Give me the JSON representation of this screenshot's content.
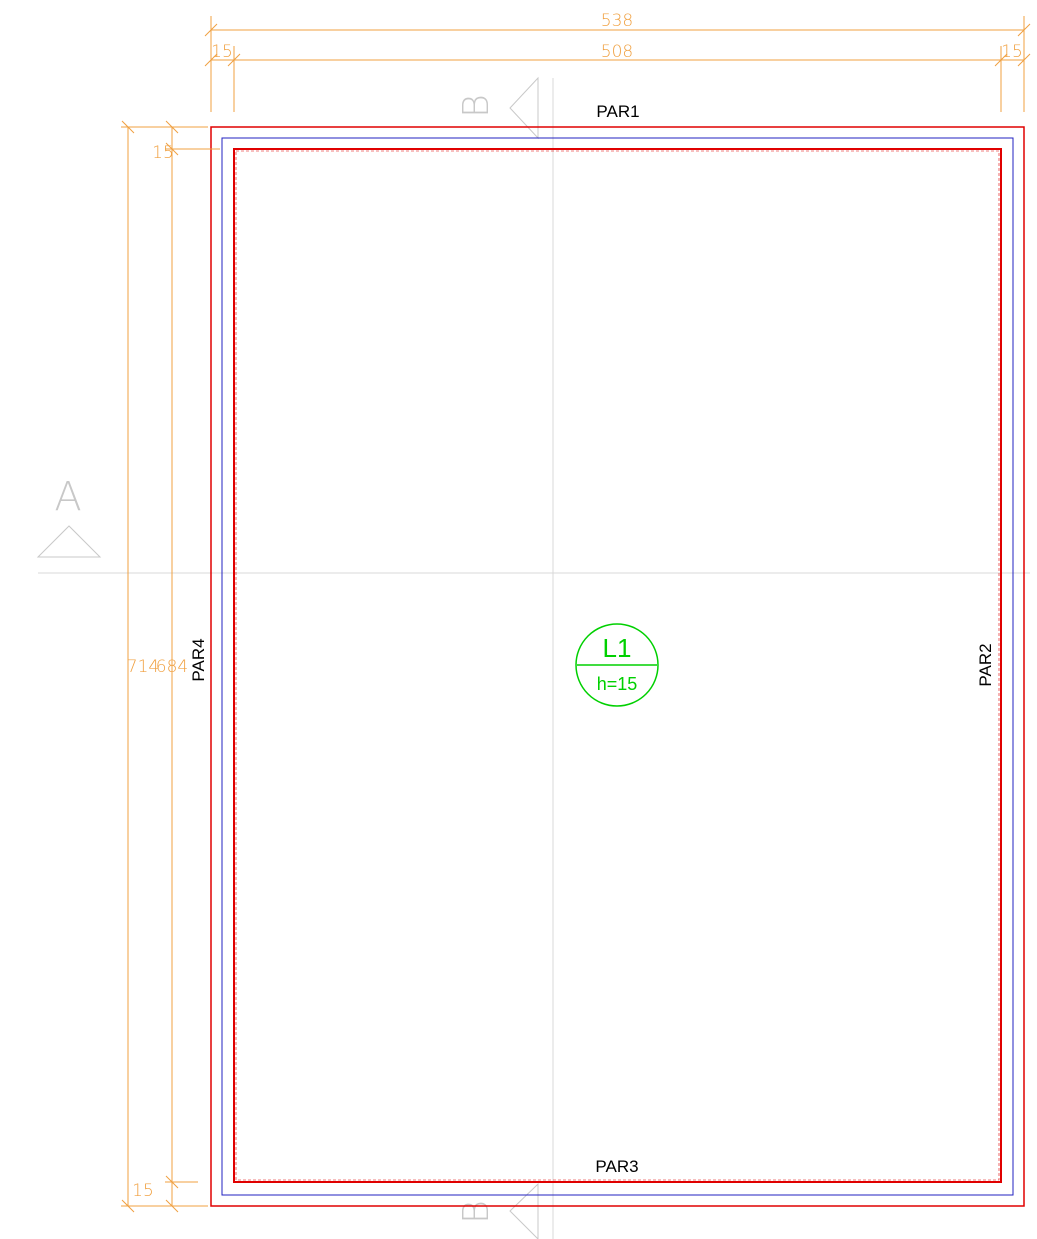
{
  "dimensions": {
    "overall_width": "538",
    "inner_width": "508",
    "left_offset": "15",
    "right_offset": "15",
    "overall_height": "714",
    "inner_height": "684",
    "top_offset": "15",
    "bottom_offset": "15"
  },
  "walls": {
    "top": "PAR1",
    "right": "PAR2",
    "bottom": "PAR3",
    "left": "PAR4"
  },
  "section_markers": {
    "horizontal": "A",
    "vertical_top": "B",
    "vertical_bottom": "B"
  },
  "slab": {
    "name": "L1",
    "thickness": "h=15"
  },
  "colors": {
    "outer_outline": "#e00000",
    "inner_outline": "#e00000",
    "middle_outline": "#2020c0",
    "dimension": "#f0a040",
    "section_line": "#d8d8d8",
    "slab_tag": "#00d000",
    "label": "#000000"
  }
}
